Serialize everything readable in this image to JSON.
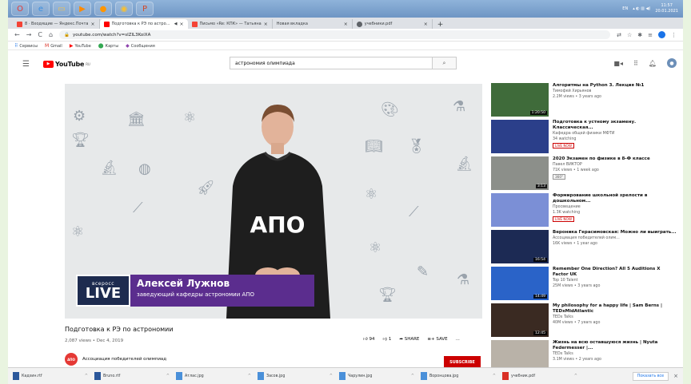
{
  "os_taskbar": {
    "apps": [
      "opera-icon",
      "ie-icon",
      "explorer-icon",
      "media-icon",
      "firefox-icon",
      "chrome-icon",
      "powerpoint-icon"
    ],
    "lang": "EN",
    "time": "11:57",
    "date": "20.01.2021"
  },
  "tabs": [
    {
      "label": "8 · Входящие — Яндекс.Почта",
      "color": "#f44336"
    },
    {
      "label": "Подготовка к РЭ по астрономии",
      "color": "#ff0000",
      "active": true
    },
    {
      "label": "Письмо «Re: КПК» — Татьяна",
      "color": "#f44336"
    },
    {
      "label": "Новая вкладка",
      "color": "#9e9e9e"
    },
    {
      "label": "учебники.pdf",
      "color": "#5f6368"
    }
  ],
  "address": {
    "url": "youtube.com/watch?v=sIZlL3KoiXA"
  },
  "bookmarks": [
    "Сервисы",
    "Gmail",
    "YouTube",
    "Карты",
    "Сообщения"
  ],
  "youtube": {
    "logo": "YouTube",
    "logo_region": "RU",
    "search_value": "астрономия олимпиада"
  },
  "video": {
    "lower_small": "всеросс",
    "lower_big": "LIVE",
    "person_name": "Алексей Лужнов",
    "person_role": "заведующий кафедры астрономии АПО",
    "shirt_text": "АПО",
    "title": "Подготовка к РЭ по астрономии",
    "meta": "2,087 views • Dec 4, 2019",
    "likes": "94",
    "dislikes": "1",
    "share": "SHARE",
    "save": "SAVE",
    "more": "...",
    "channel": "Ассоциация победителей олимпиад",
    "channel_abbr": "АПО",
    "subscribe": "SUBSCRIBE"
  },
  "sidebar": [
    {
      "title": "Алгоритмы на Python 3. Лекция №1",
      "channel": "Тимофей Хирьянов",
      "meta": "2.2M views • 3 years ago",
      "duration": "1:20:50",
      "badge": "",
      "thumb": "#3f6b3a"
    },
    {
      "title": "Подготовка к устному экзамену. Классическая...",
      "channel": "Кафедра общей физики МФТИ",
      "meta": "34 watching",
      "duration": "",
      "badge": "LIVE NOW",
      "thumb": "#2b3f8a"
    },
    {
      "title": "2020 Экзамен по физике в 8-Ф классе",
      "channel": "Павел ВИКТОР",
      "meta": "71K views • 1 week ago",
      "duration": "3:13",
      "badge": "360°",
      "thumb": "#8c8f8a"
    },
    {
      "title": "Формирование школьной зрелости в дошкольном...",
      "channel": "Просвещение",
      "meta": "1.3K watching",
      "duration": "",
      "badge": "LIVE NOW",
      "thumb": "#7b8fd6"
    },
    {
      "title": "Вероника Герасимовская: Можно ли выиграть...",
      "channel": "Ассоциация победителей олим...",
      "meta": "16K views • 1 year ago",
      "duration": "16:54",
      "badge": "",
      "thumb": "#1c2a54"
    },
    {
      "title": "Remember One Direction? All 5 Auditions X Factor UK",
      "channel": "Top 10 Talent",
      "meta": "25M views • 3 years ago",
      "duration": "14:49",
      "badge": "",
      "thumb": "#2a63c8"
    },
    {
      "title": "My philosophy for a happy life | Sam Berns | TEDxMidAtlantic",
      "channel": "TEDx Talks",
      "meta": "40M views • 7 years ago",
      "duration": "12:45",
      "badge": "",
      "thumb": "#3a2a22"
    },
    {
      "title": "Жизнь на всю оставшуюся жизнь | Nyuta Federmesser |...",
      "channel": "TEDx Talks",
      "meta": "3.1M views • 2 years ago",
      "duration": "20:03",
      "badge": "",
      "thumb": "#b9b2a8"
    }
  ],
  "downloads": [
    {
      "name": "Кадзин.rtf",
      "color": "#2b579a"
    },
    {
      "name": "Bruno.rtf",
      "color": "#2b579a"
    },
    {
      "name": "Атлас.jpg",
      "color": "#4a90d9"
    },
    {
      "name": "Засов.jpg",
      "color": "#4a90d9"
    },
    {
      "name": "Чарулин.jpg",
      "color": "#4a90d9"
    },
    {
      "name": "Воронцова.jpg",
      "color": "#4a90d9"
    },
    {
      "name": "учебник.pdf",
      "color": "#d93025"
    }
  ],
  "show_all": "Показать все"
}
